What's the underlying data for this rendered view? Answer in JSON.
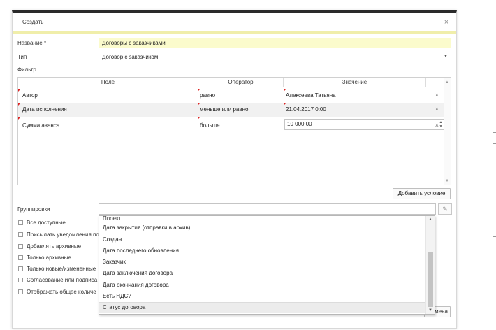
{
  "dialog": {
    "title": "Создать",
    "close_glyph": "×"
  },
  "form": {
    "name_label": "Название *",
    "name_value": "Договоры с заказчиками",
    "type_label": "Тип",
    "type_value": "Договор с заказчиком",
    "filter_label": "Фильтр",
    "grouping_label": "Группировки"
  },
  "grid": {
    "headers": {
      "field": "Поле",
      "operator": "Оператор",
      "value": "Значение"
    },
    "rows": [
      {
        "field": "Автор",
        "operator": "равно",
        "value": "Алексеева Татьяна"
      },
      {
        "field": "Дата исполнения",
        "operator": "меньше или равно",
        "value": "21.04.2017 0:00"
      },
      {
        "field": "Сумма аванса",
        "operator": "больше",
        "value": "10 000,00"
      }
    ],
    "remove_glyph": "×"
  },
  "buttons": {
    "add_condition": "Добавить условие",
    "cancel_partial": "мена"
  },
  "checkboxes": [
    "Все доступные",
    "Присылать уведомления по",
    "Добавлять архивные",
    "Только архивные",
    "Только новые/измененные",
    "Согласование или подписа",
    "Отображать общее количе"
  ],
  "dropdown": {
    "options": [
      "Проект",
      "Дата закрытия (отправки в архив)",
      "Создан",
      "Дата последнего обновления",
      "Заказчик",
      "Дата заключения договора",
      "Дата окончания договора",
      "Есть НДС?",
      "Статус договора"
    ],
    "selected": "Статус договора"
  },
  "icons": {
    "dropdown_arrow": "chevron-down-icon",
    "pencil": "pencil-icon",
    "close": "close-icon",
    "spinner": "spinner-arrows-icon"
  },
  "colors": {
    "name_field_bg": "#fbfbcc",
    "header_accent": "#f0eeaa",
    "required_marker": "#dd2222",
    "selected_option_bg": "#ececec"
  }
}
